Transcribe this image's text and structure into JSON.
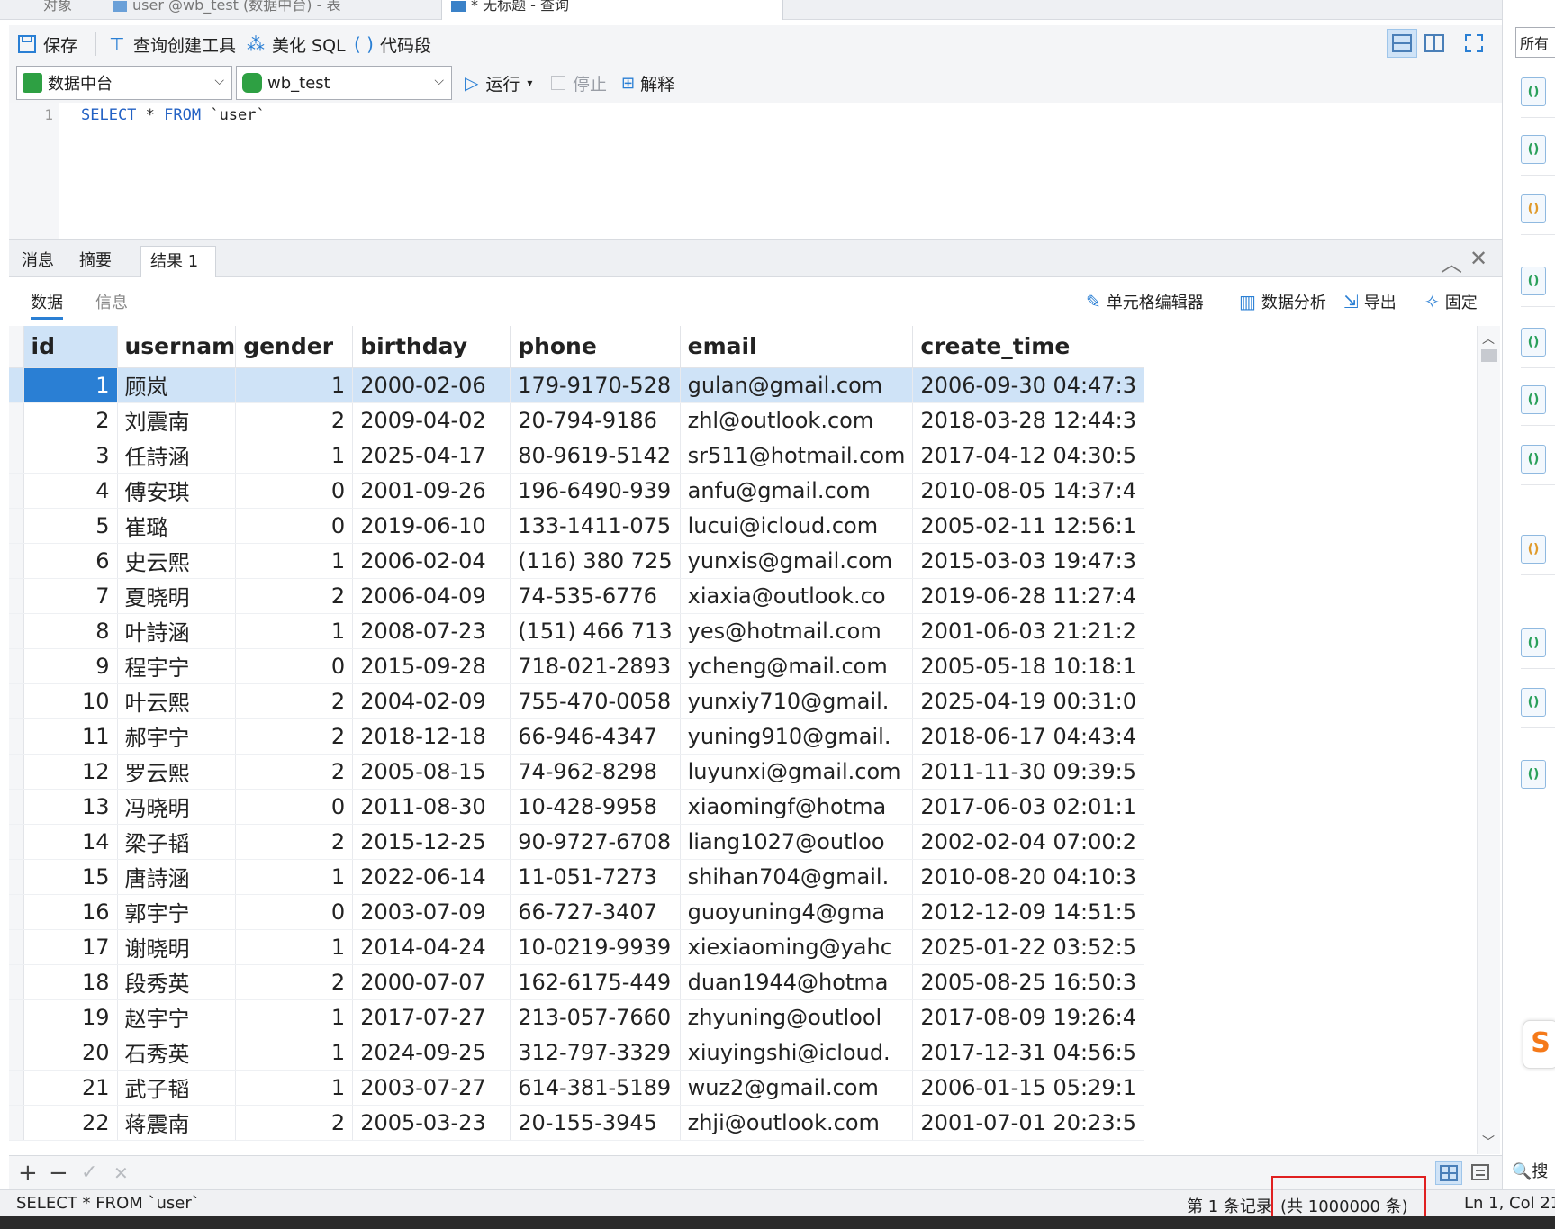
{
  "tabs": [
    {
      "label": "对象"
    },
    {
      "label": "user @wb_test (数据中台) - 表"
    },
    {
      "label": "* 无标题 - 查询"
    }
  ],
  "toolbar": {
    "save": "保存",
    "query_builder": "查询创建工具",
    "beautify": "美化 SQL",
    "snippet": "代码段"
  },
  "connection": {
    "name": "数据中台",
    "database": "wb_test"
  },
  "run_controls": {
    "run": "运行",
    "stop": "停止",
    "explain": "解释"
  },
  "editor": {
    "line_number": "1",
    "kw_select": "SELECT",
    "star": " * ",
    "kw_from": "FROM",
    "table": " `user`"
  },
  "result_tabs": [
    "消息",
    "摘要",
    "结果 1"
  ],
  "sub_tabs": {
    "data": "数据",
    "info": "信息"
  },
  "result_tools": {
    "cell_editor": "单元格编辑器",
    "analysis": "数据分析",
    "export": "导出",
    "pin": "固定"
  },
  "columns": [
    "id",
    "usernam",
    "gender",
    "birthday",
    "phone",
    "email",
    "create_time"
  ],
  "rows": [
    [
      "1",
      "顾岚",
      "1",
      "2000-02-06",
      "179-9170-528",
      "gulan@gmail.com",
      "2006-09-30 04:47:3"
    ],
    [
      "2",
      "刘震南",
      "2",
      "2009-04-02",
      "20-794-9186",
      "zhl@outlook.com",
      "2018-03-28 12:44:3"
    ],
    [
      "3",
      "任詩涵",
      "1",
      "2025-04-17",
      "80-9619-5142",
      "sr511@hotmail.com",
      "2017-04-12 04:30:5"
    ],
    [
      "4",
      "傅安琪",
      "0",
      "2001-09-26",
      "196-6490-939",
      "anfu@gmail.com",
      "2010-08-05 14:37:4"
    ],
    [
      "5",
      "崔璐",
      "0",
      "2019-06-10",
      "133-1411-075",
      "lucui@icloud.com",
      "2005-02-11 12:56:1"
    ],
    [
      "6",
      "史云熙",
      "1",
      "2006-02-04",
      "(116) 380 725",
      "yunxis@gmail.com",
      "2015-03-03 19:47:3"
    ],
    [
      "7",
      "夏晓明",
      "2",
      "2006-04-09",
      "74-535-6776",
      "xiaxia@outlook.co",
      "2019-06-28 11:27:4"
    ],
    [
      "8",
      "叶詩涵",
      "1",
      "2008-07-23",
      "(151) 466 713",
      "yes@hotmail.com",
      "2001-06-03 21:21:2"
    ],
    [
      "9",
      "程宇宁",
      "0",
      "2015-09-28",
      "718-021-2893",
      "ycheng@mail.com",
      "2005-05-18 10:18:1"
    ],
    [
      "10",
      "叶云熙",
      "2",
      "2004-02-09",
      "755-470-0058",
      "yunxiy710@gmail.",
      "2025-04-19 00:31:0"
    ],
    [
      "11",
      "郝宇宁",
      "2",
      "2018-12-18",
      "66-946-4347",
      "yuning910@gmail.",
      "2018-06-17 04:43:4"
    ],
    [
      "12",
      "罗云熙",
      "2",
      "2005-08-15",
      "74-962-8298",
      "luyunxi@gmail.com",
      "2011-11-30 09:39:5"
    ],
    [
      "13",
      "冯晓明",
      "0",
      "2011-08-30",
      "10-428-9958",
      "xiaomingf@hotma",
      "2017-06-03 02:01:1"
    ],
    [
      "14",
      "梁子韬",
      "2",
      "2015-12-25",
      "90-9727-6708",
      "liang1027@outloo",
      "2002-02-04 07:00:2"
    ],
    [
      "15",
      "唐詩涵",
      "1",
      "2022-06-14",
      "11-051-7273",
      "shihan704@gmail.",
      "2010-08-20 04:10:3"
    ],
    [
      "16",
      "郭宇宁",
      "0",
      "2003-07-09",
      "66-727-3407",
      "guoyuning4@gma",
      "2012-12-09 14:51:5"
    ],
    [
      "17",
      "谢晓明",
      "1",
      "2014-04-24",
      "10-0219-9939",
      "xiexiaoming@yahc",
      "2025-01-22 03:52:5"
    ],
    [
      "18",
      "段秀英",
      "2",
      "2000-07-07",
      "162-6175-449",
      "duan1944@hotma",
      "2005-08-25 16:50:3"
    ],
    [
      "19",
      "赵宇宁",
      "1",
      "2017-07-27",
      "213-057-7660",
      "zhyuning@outlool",
      "2017-08-09 19:26:4"
    ],
    [
      "20",
      "石秀英",
      "1",
      "2024-09-25",
      "312-797-3329",
      "xiuyingshi@icloud.",
      "2017-12-31 04:56:5"
    ],
    [
      "21",
      "武子韬",
      "1",
      "2003-07-27",
      "614-381-5189",
      "wuz2@gmail.com",
      "2006-01-15 05:29:1"
    ],
    [
      "22",
      "蒋震南",
      "2",
      "2005-03-23",
      "20-155-3945",
      "zhji@outlook.com",
      "2001-07-01 20:23:5"
    ]
  ],
  "grid_footer": {
    "add": "+",
    "remove": "−",
    "apply": "✓",
    "discard": "✕"
  },
  "status": {
    "sql": "SELECT * FROM `user`",
    "record": "第 1 条记录",
    "total": "(共 1000000 条)",
    "cursor": "Ln 1, Col 21"
  },
  "right_panel": {
    "filter": "所有",
    "search": "搜"
  },
  "colors": {
    "accent": "#2a7fd4",
    "selection": "#cfe3f7",
    "highlight_box": "#e02020",
    "keyword": "#2261c4"
  }
}
